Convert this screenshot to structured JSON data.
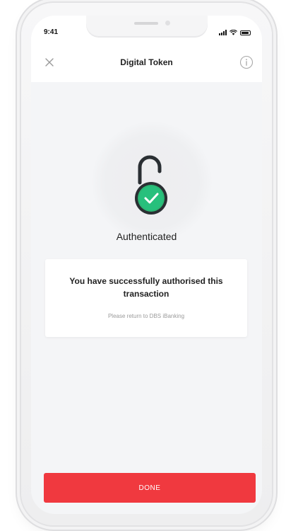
{
  "status_bar": {
    "time": "9:41"
  },
  "nav": {
    "title": "Digital Token",
    "close_icon": "close-icon",
    "info_icon": "info-icon"
  },
  "lock": {
    "icon": "unlocked-padlock-check-icon",
    "status": "Authenticated"
  },
  "card": {
    "message": "You have successfully authorised this transaction",
    "sub": "Please return to DBS iBanking"
  },
  "actions": {
    "done_label": "DONE"
  },
  "colors": {
    "accent_red": "#f0393f",
    "success_green": "#2bb673",
    "lock_body": "#2a2f33"
  }
}
